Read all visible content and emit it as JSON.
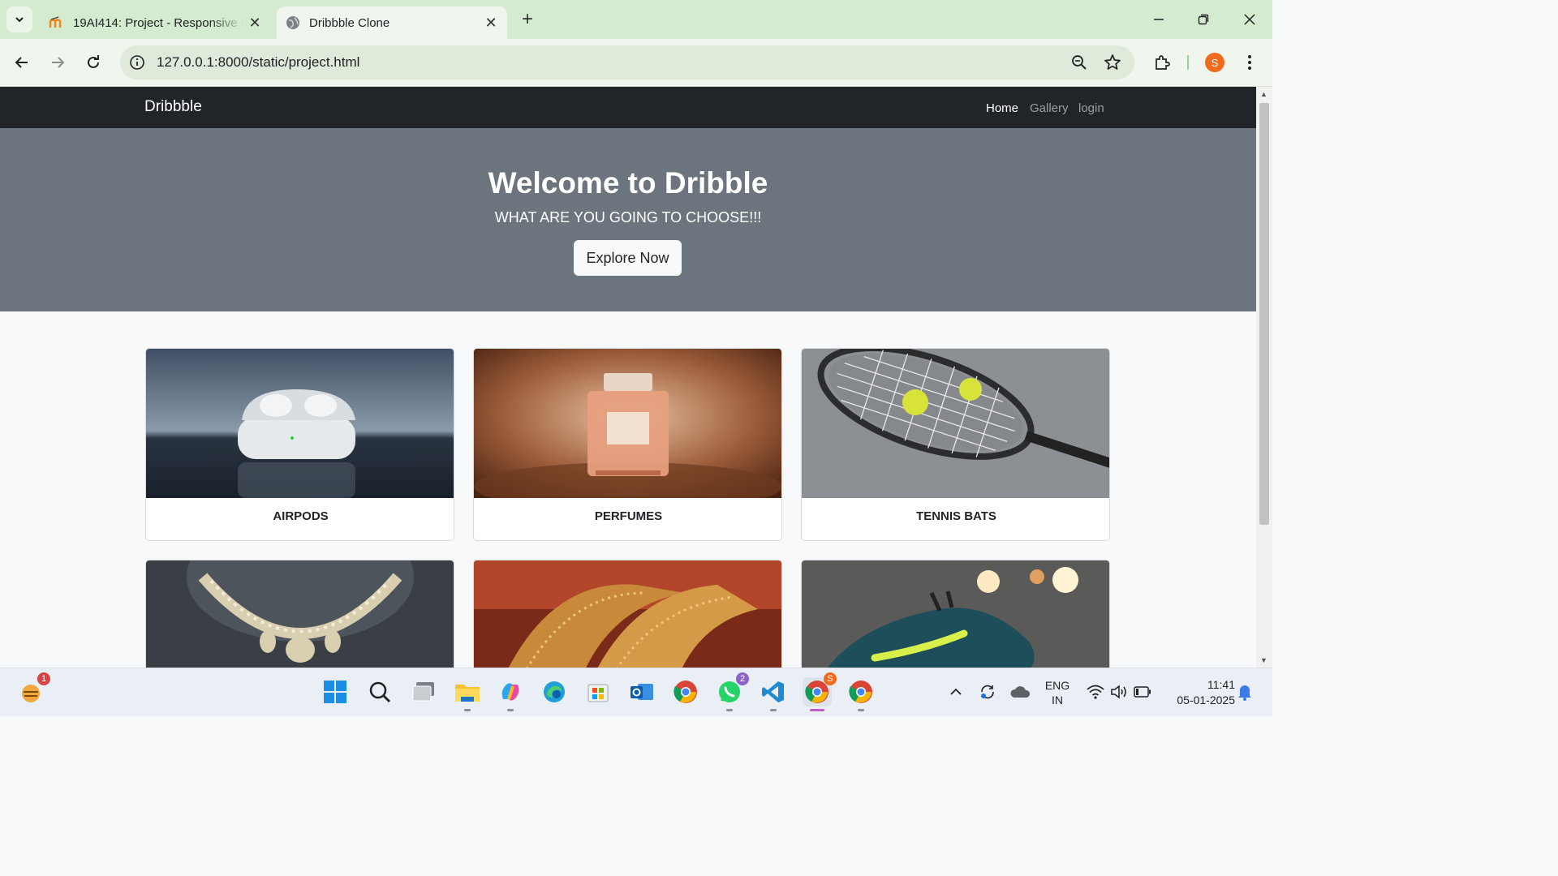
{
  "browser": {
    "tabs": [
      {
        "title": "19AI414: Project - Responsive W",
        "active": false
      },
      {
        "title": "Dribbble Clone",
        "active": true
      }
    ],
    "url": "127.0.0.1:8000/static/project.html",
    "profile_initial": "S",
    "profile_color": "#f26b1d"
  },
  "page": {
    "brand": "Dribbble",
    "nav": [
      {
        "label": "Home",
        "active": true
      },
      {
        "label": "Gallery",
        "active": false
      },
      {
        "label": "login",
        "active": false
      }
    ],
    "hero": {
      "title": "Welcome to Dribble",
      "subtitle": "WHAT ARE YOU GOING TO CHOOSE!!!",
      "button": "Explore Now"
    },
    "cards": [
      {
        "label": "AIRPODS",
        "icon": "airpods-photo"
      },
      {
        "label": "PERFUMES",
        "icon": "perfume-photo"
      },
      {
        "label": "TENNIS BATS",
        "icon": "tennis-racket-photo"
      },
      {
        "label": "",
        "icon": "necklace-photo"
      },
      {
        "label": "",
        "icon": "bangles-photo"
      },
      {
        "label": "",
        "icon": "sneakers-photo"
      }
    ]
  },
  "taskbar": {
    "widgets_badge": "1",
    "whatsapp_badge": "2",
    "chrome_profile_badge": "S",
    "language": "ENG",
    "region": "IN",
    "time": "11:41",
    "date": "05-01-2025"
  },
  "colors": {
    "navbar": "#212529",
    "hero": "#6c757d",
    "tabbar": "#d4ebd0"
  }
}
